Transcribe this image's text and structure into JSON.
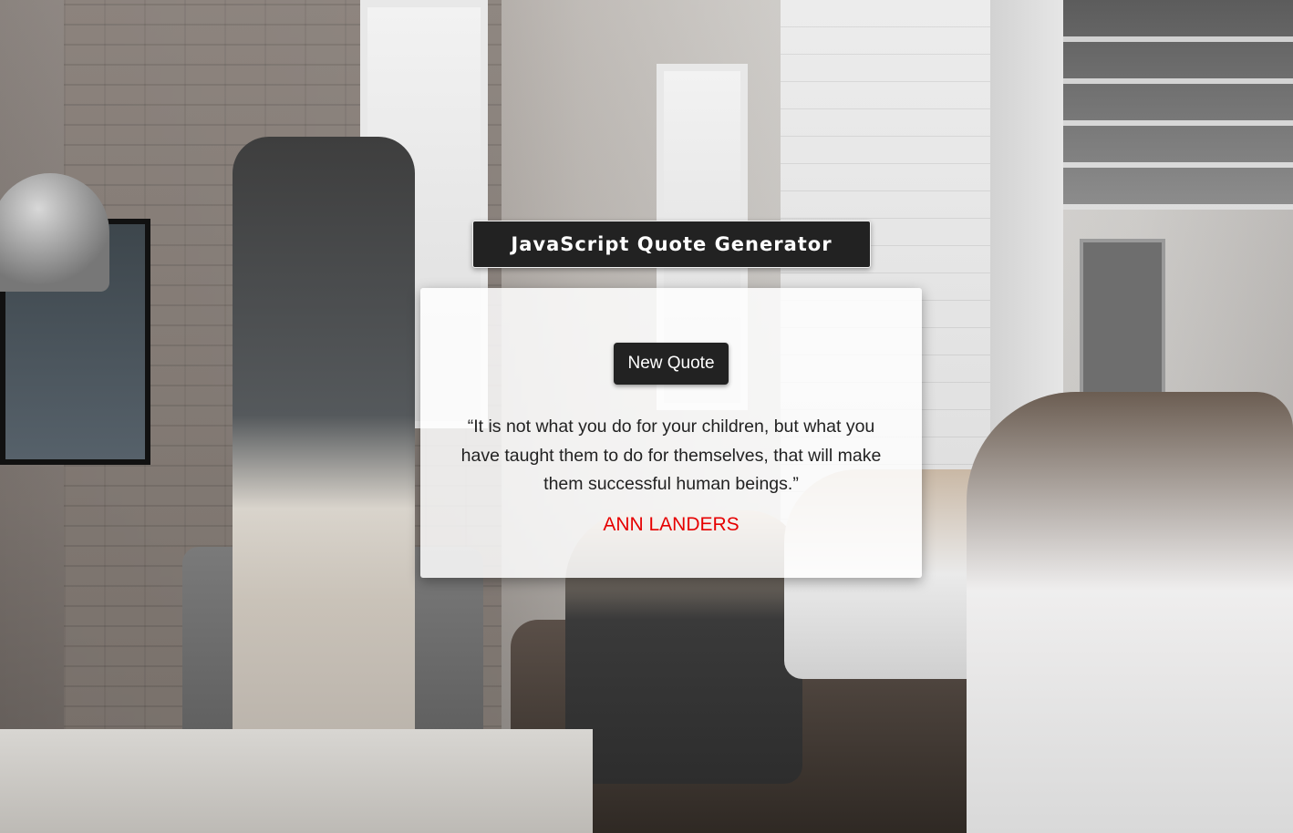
{
  "header": {
    "title": "JavaScript Quote Generator"
  },
  "quote_card": {
    "button_label": "New Quote",
    "quote": "“It is not what you do for your children, but what you have taught them to do for themselves, that will make them successful human beings.”",
    "author": "ANN LANDERS"
  },
  "background": {
    "icon": "office-photo-image"
  },
  "colors": {
    "header_bg": "#222222",
    "button_bg": "#222222",
    "author": "#e60000",
    "card_bg": "#ffffff"
  }
}
